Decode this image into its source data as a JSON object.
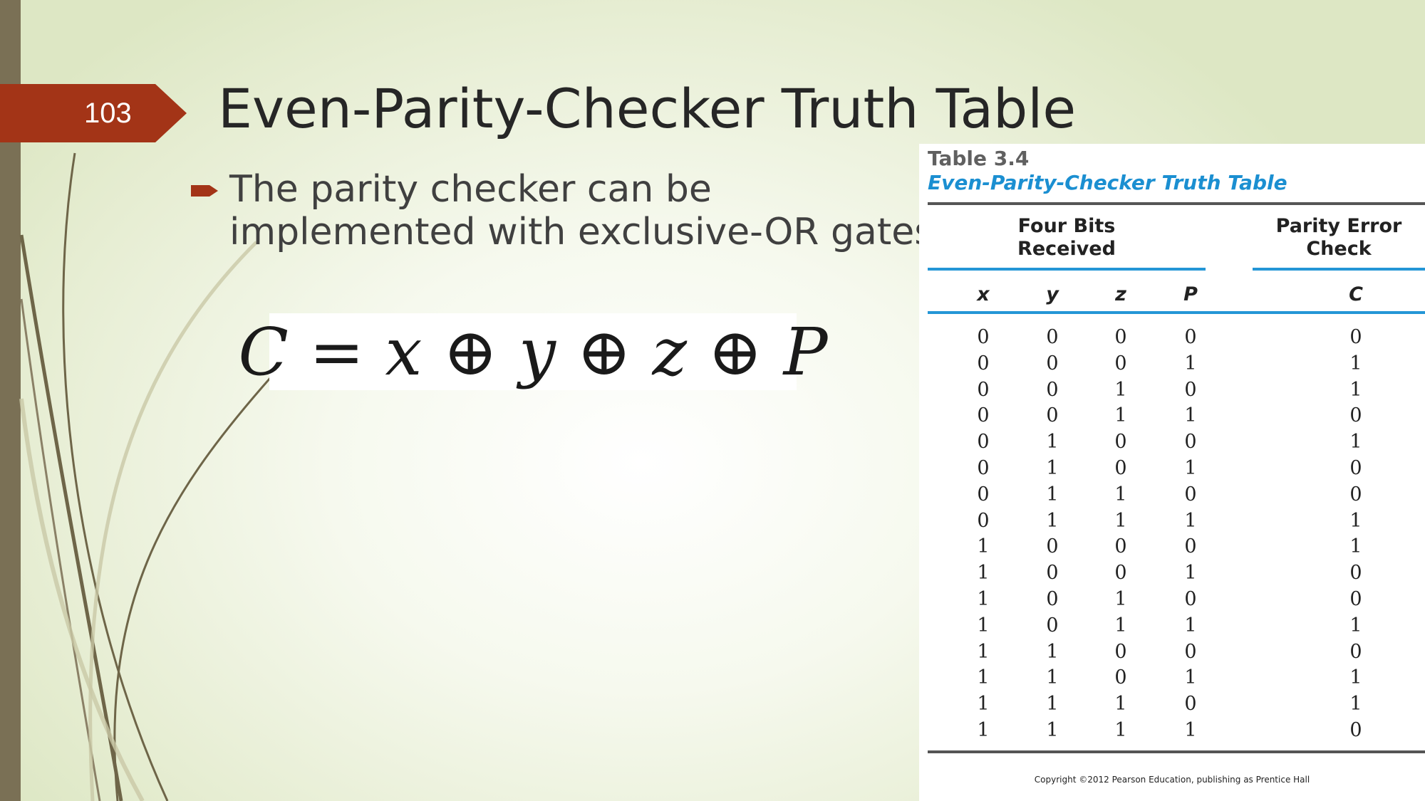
{
  "slide": {
    "number": "103",
    "title": "Even-Parity-Checker Truth Table",
    "bullet_line1": "The parity checker can be",
    "bullet_line2": "implemented with exclusive-OR gates",
    "formula": "C = x ⊕ y ⊕ z ⊕ P",
    "accent_color": "#a33417",
    "bar_color": "#7a7055"
  },
  "table": {
    "number": "Table 3.4",
    "caption": "Even-Parity-Checker Truth Table",
    "group_left_line1": "Four Bits",
    "group_left_line2": "Received",
    "group_right_line1": "Parity Error",
    "group_right_line2": "Check",
    "columns": [
      "x",
      "y",
      "z",
      "P",
      "C"
    ],
    "rows": [
      [
        "0",
        "0",
        "0",
        "0",
        "0"
      ],
      [
        "0",
        "0",
        "0",
        "1",
        "1"
      ],
      [
        "0",
        "0",
        "1",
        "0",
        "1"
      ],
      [
        "0",
        "0",
        "1",
        "1",
        "0"
      ],
      [
        "0",
        "1",
        "0",
        "0",
        "1"
      ],
      [
        "0",
        "1",
        "0",
        "1",
        "0"
      ],
      [
        "0",
        "1",
        "1",
        "0",
        "0"
      ],
      [
        "0",
        "1",
        "1",
        "1",
        "1"
      ],
      [
        "1",
        "0",
        "0",
        "0",
        "1"
      ],
      [
        "1",
        "0",
        "0",
        "1",
        "0"
      ],
      [
        "1",
        "0",
        "1",
        "0",
        "0"
      ],
      [
        "1",
        "0",
        "1",
        "1",
        "1"
      ],
      [
        "1",
        "1",
        "0",
        "0",
        "0"
      ],
      [
        "1",
        "1",
        "0",
        "1",
        "1"
      ],
      [
        "1",
        "1",
        "1",
        "0",
        "1"
      ],
      [
        "1",
        "1",
        "1",
        "1",
        "0"
      ]
    ],
    "copyright": "Copyright ©2012 Pearson Education, publishing as Prentice Hall"
  }
}
